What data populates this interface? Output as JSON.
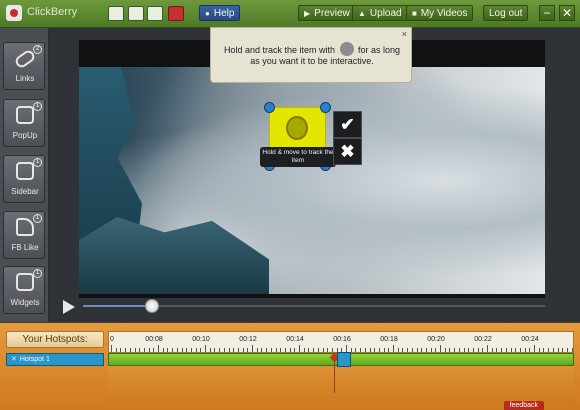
{
  "app": {
    "title": "ClickBerry"
  },
  "toolbar": {
    "icons": [
      "new-file-icon",
      "open-folder-icon",
      "save-icon",
      "record-icon"
    ],
    "help_label": "Help",
    "preview_label": "Preview",
    "upload_label": "Upload",
    "my_videos_label": "My Videos",
    "logout_label": "Log out",
    "minimize_glyph": "−",
    "close_glyph": "✕"
  },
  "sidebar": {
    "items": [
      {
        "label": "Links",
        "badge": "2",
        "icon": "link-icon"
      },
      {
        "label": "PopUp",
        "badge": "1",
        "icon": "popup-icon"
      },
      {
        "label": "Sidebar",
        "badge": "1",
        "icon": "sidebar-icon"
      },
      {
        "label": "FB Like",
        "badge": "1",
        "icon": "thumbs-up-icon"
      },
      {
        "label": "Widgets",
        "badge": "1",
        "icon": "widgets-icon"
      }
    ]
  },
  "tooltip": {
    "text_before": "Hold and track the item with",
    "text_after": "for as long as you want it to be interactive.",
    "close_glyph": "×"
  },
  "hotspot": {
    "hint": "Hold & move to track the item",
    "confirm_glyph": "✔",
    "cancel_glyph": "✖"
  },
  "player": {
    "progress": 0.15
  },
  "timeline": {
    "header": "Your Hotspots:",
    "ticks": [
      "0",
      "00:08",
      "00:10",
      "00:12",
      "00:14",
      "00:16",
      "00:18",
      "00:20",
      "00:22",
      "00:24"
    ],
    "hotspot_name": "Hotspot 1",
    "feedback_label": "feedback"
  },
  "colors": {
    "accent_green": "#5b8432",
    "hotspot_yellow": "#e4e500",
    "timeline_orange": "#e59a3c",
    "track_green": "#8fd23b"
  }
}
